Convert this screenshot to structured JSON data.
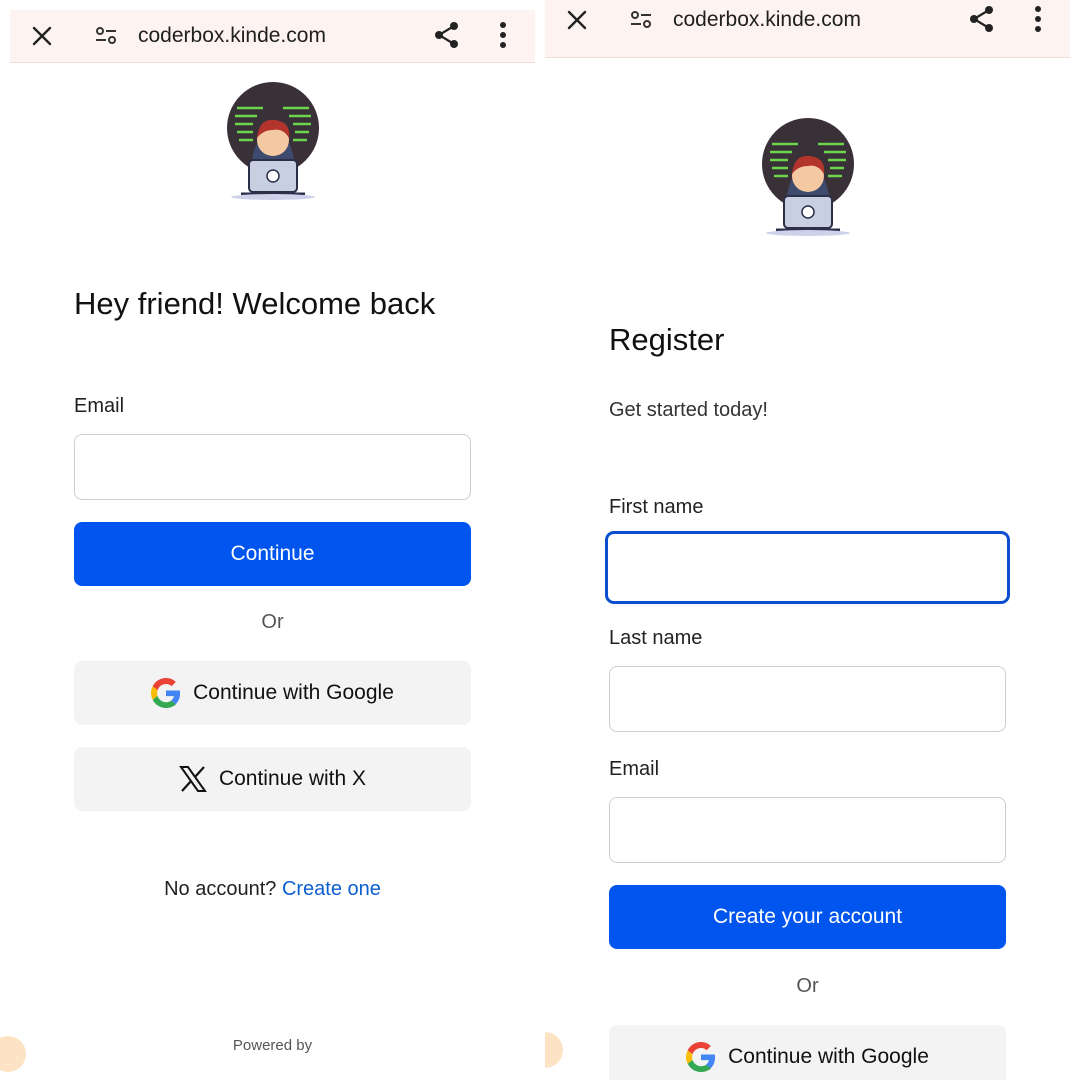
{
  "left": {
    "browser": {
      "url": "coderbox.kinde.com",
      "close_icon": "close-icon",
      "site_icon": "site-settings-icon",
      "share_icon": "share-icon",
      "menu_icon": "more-vert-icon"
    },
    "title": "Hey friend! Welcome back",
    "email_label": "Email",
    "email_value": "",
    "continue_label": "Continue",
    "or_label": "Or",
    "google_label": "Continue with Google",
    "x_label": "Continue with X",
    "no_account_text": "No account?",
    "create_link": "Create one",
    "powered_by": "Powered by"
  },
  "right": {
    "browser": {
      "url": "coderbox.kinde.com",
      "close_icon": "close-icon",
      "site_icon": "site-settings-icon",
      "share_icon": "share-icon",
      "menu_icon": "more-vert-icon"
    },
    "title": "Register",
    "subtitle": "Get started today!",
    "first_name_label": "First name",
    "last_name_label": "Last name",
    "email_label": "Email",
    "create_account_label": "Create your account",
    "or_label": "Or",
    "google_label": "Continue with Google"
  },
  "colors": {
    "primary": "#0055ee",
    "link": "#0b5fd0",
    "focus": "#0b4fd0",
    "social_bg": "#f3f3f3"
  }
}
